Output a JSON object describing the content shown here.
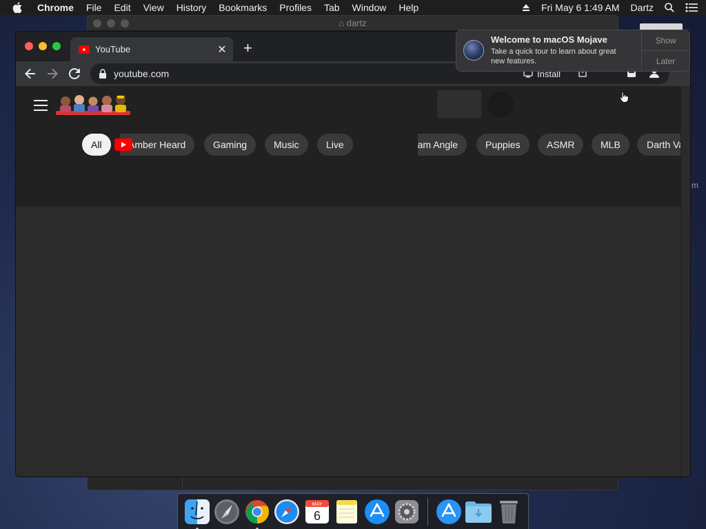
{
  "menubar": {
    "app_name": "Chrome",
    "items": [
      "File",
      "Edit",
      "View",
      "History",
      "Bookmarks",
      "Profiles",
      "Tab",
      "Window",
      "Help"
    ],
    "datetime": "Fri May 6  1:49 AM",
    "user": "Dartz"
  },
  "background_window": {
    "title": "dartz"
  },
  "browser": {
    "tab_title": "YouTube",
    "url": "youtube.com",
    "install_label": "Install"
  },
  "youtube": {
    "chips": [
      "All",
      "Amber Heard",
      "Gaming",
      "Music",
      "Live"
    ],
    "chips_right": [
      "Puppies",
      "ASMR",
      "MLB"
    ],
    "chip_partial_left": "am Angle",
    "chip_partial_right": "Darth Va"
  },
  "notification": {
    "title": "Welcome to macOS Mojave",
    "body": "Take a quick tour to learn about great new features.",
    "show_label": "Show",
    "later_label": "Later"
  },
  "edge_text": "m",
  "dock": {
    "items": [
      "finder-icon",
      "launchpad-icon",
      "chrome-icon",
      "safari-icon",
      "calendar-icon",
      "notes-icon",
      "app-store-icon",
      "system-preferences-icon",
      "app-store-downloads-icon",
      "downloads-folder-icon",
      "trash-icon"
    ],
    "calendar_month": "MAY",
    "calendar_day": "6"
  },
  "colors": {
    "youtube_red": "#ff0000",
    "chip_active_bg": "#f1f1f1",
    "chip_bg": "#3a3a3a",
    "page_bg": "#2b2b2b"
  }
}
